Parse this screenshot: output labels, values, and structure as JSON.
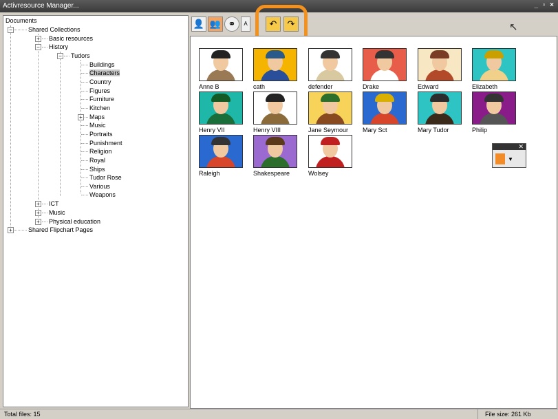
{
  "window": {
    "title": "Activresource Manager...",
    "controls": "_ ▫ ×"
  },
  "tree": {
    "root": "Documents",
    "shared_collections": "Shared Collections",
    "basic_resources": "Basic resources",
    "history": "History",
    "tudors": "Tudors",
    "tudor_items": [
      "Buildings",
      "Characters",
      "Country",
      "Figures",
      "Furniture",
      "Kitchen",
      "Maps",
      "Music",
      "Portraits",
      "Punishment",
      "Religion",
      "Royal",
      "Ships",
      "Tudor Rose",
      "Various",
      "Weapons"
    ],
    "selected": "Characters",
    "ict": "ICT",
    "music": "Music",
    "physical_education": "Physical education",
    "shared_flipchart": "Shared Flipchart Pages"
  },
  "toolbar": {
    "icons": [
      "single-user-icon",
      "multi-user-icon",
      "link-icon",
      "text-icon",
      "folder-back-icon",
      "folder-forward-icon"
    ]
  },
  "thumbnails": [
    {
      "label": "Anne B",
      "bg": "#ffffff",
      "hat": "#222222",
      "body": "#9a7a55"
    },
    {
      "label": "cath",
      "bg": "#f4b400",
      "hat": "#2a5a8a",
      "body": "#2a4f9a"
    },
    {
      "label": "defender",
      "bg": "#ffffff",
      "hat": "#333333",
      "body": "#d8c9a0"
    },
    {
      "label": "Drake",
      "bg": "#e85c4a",
      "hat": "#333333",
      "body": "#ffffff"
    },
    {
      "label": "Edward",
      "bg": "#f7e7c2",
      "hat": "#7a3c25",
      "body": "#b24a2a"
    },
    {
      "label": "Elizabeth",
      "bg": "#2ec4c4",
      "hat": "#c9a000",
      "body": "#f1d08a"
    },
    {
      "label": "Henry VII",
      "bg": "#1fb7a8",
      "hat": "#145a24",
      "body": "#1a6e3a"
    },
    {
      "label": "Henry VIII",
      "bg": "#ffffff",
      "hat": "#222222",
      "body": "#8c6b3a"
    },
    {
      "label": "Jane Seymour",
      "bg": "#f7d35a",
      "hat": "#2c6e2c",
      "body": "#8a4a1f"
    },
    {
      "label": "Mary Sct",
      "bg": "#2a6ad0",
      "hat": "#d9b000",
      "body": "#d7452a"
    },
    {
      "label": "Mary Tudor",
      "bg": "#2ec4c4",
      "hat": "#2c2c2c",
      "body": "#3a2a1a"
    },
    {
      "label": "Philip",
      "bg": "#8a1c8a",
      "hat": "#333333",
      "body": "#555555"
    },
    {
      "label": "Raleigh",
      "bg": "#2a6ad0",
      "hat": "#333333",
      "body": "#d7452a"
    },
    {
      "label": "Shakespeare",
      "bg": "#9a6ad0",
      "hat": "#5a3a1a",
      "body": "#2c6e2c"
    },
    {
      "label": "Wolsey",
      "bg": "#ffffff",
      "hat": "#c0201f",
      "body": "#c0201f"
    }
  ],
  "status": {
    "total_files": "Total files: 15",
    "file_size": "File size: 261 Kb"
  },
  "colors": {
    "highlight": "#f2911e",
    "titlebar": "#4a4a4a"
  }
}
